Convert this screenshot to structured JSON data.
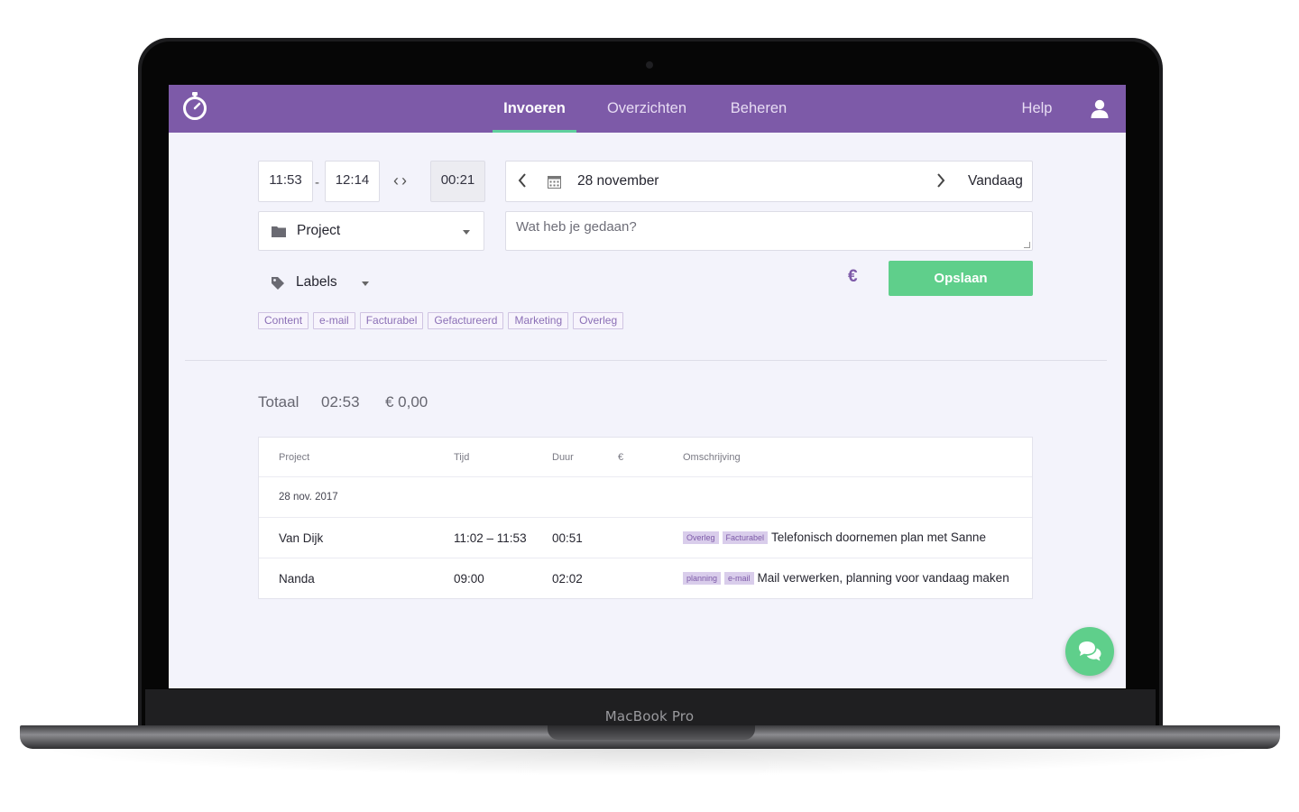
{
  "device": {
    "model_label": "MacBook Pro"
  },
  "nav": {
    "tabs": [
      {
        "label": "Invoeren",
        "active": true
      },
      {
        "label": "Overzichten",
        "active": false
      },
      {
        "label": "Beheren",
        "active": false
      }
    ],
    "help_label": "Help"
  },
  "entry": {
    "start_time": "11:53",
    "separator": "-",
    "end_time": "12:14",
    "duration": "00:21",
    "date": "28 november",
    "today_label": "Vandaag",
    "project_placeholder": "Project",
    "description_placeholder": "Wat heb je gedaan?",
    "labels_label": "Labels",
    "currency_symbol": "€",
    "save_label": "Opslaan"
  },
  "quick_labels": [
    "Content",
    "e-mail",
    "Facturabel",
    "Gefactureerd",
    "Marketing",
    "Overleg"
  ],
  "totals": {
    "label": "Totaal",
    "time": "02:53",
    "amount": "€ 0,00"
  },
  "table": {
    "headers": {
      "project": "Project",
      "time": "Tijd",
      "duration": "Duur",
      "currency": "€",
      "description": "Omschrijving"
    },
    "group_date": "28 nov. 2017",
    "rows": [
      {
        "project": "Van Dijk",
        "time": "11:02 – 11:53",
        "duration": "00:51",
        "tags": [
          "Overleg",
          "Facturabel"
        ],
        "description": "Telefonisch doornemen plan met Sanne"
      },
      {
        "project": "Nanda",
        "time": "09:00",
        "duration": "02:02",
        "tags": [
          "planning",
          "e-mail"
        ],
        "description": "Mail verwerken, planning voor vandaag maken"
      }
    ]
  },
  "colors": {
    "brand_purple": "#7d5aa8",
    "accent_green": "#5fcf8b",
    "background": "#f3f3fb"
  }
}
